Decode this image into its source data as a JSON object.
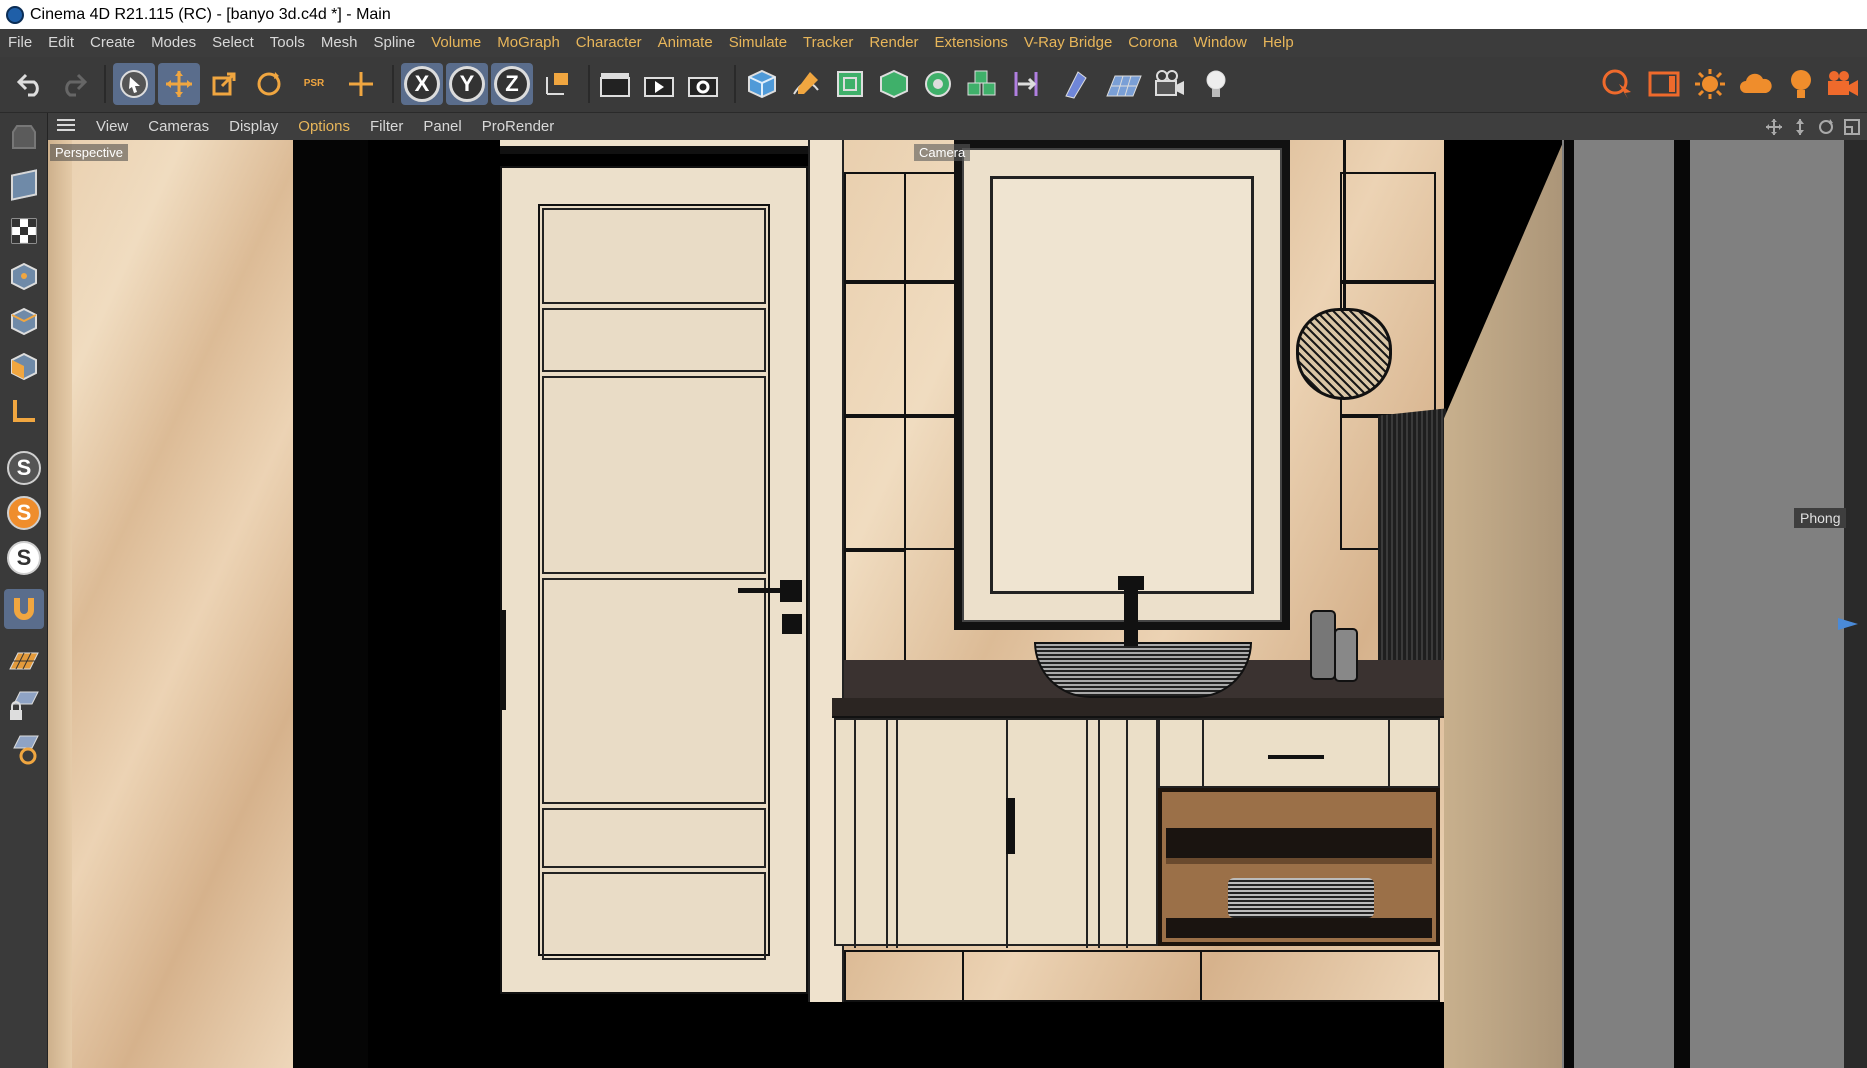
{
  "titlebar": {
    "title": "Cinema 4D R21.115 (RC) - [banyo 3d.c4d *] - Main"
  },
  "menu": [
    "File",
    "Edit",
    "Create",
    "Modes",
    "Select",
    "Tools",
    "Mesh",
    "Spline",
    "Volume",
    "MoGraph",
    "Character",
    "Animate",
    "Simulate",
    "Tracker",
    "Render",
    "Extensions",
    "V-Ray Bridge",
    "Corona",
    "Window",
    "Help"
  ],
  "menu_highlight": [
    "Volume",
    "MoGraph",
    "Character",
    "Animate",
    "Simulate",
    "Tracker",
    "Render",
    "Extensions",
    "V-Ray Bridge",
    "Corona",
    "Window",
    "Help"
  ],
  "toolbar": {
    "psr_label": "PSR",
    "axis_x": "X",
    "axis_y": "Y",
    "axis_z": "Z"
  },
  "viewport_menu": {
    "items": [
      "View",
      "Cameras",
      "Display",
      "Options",
      "Filter",
      "Panel",
      "ProRender"
    ],
    "highlight": "Options"
  },
  "viewport": {
    "view_name": "Perspective",
    "camera_label": "Camera",
    "material_label": "Phong"
  },
  "leftbar": {
    "s1": "S",
    "s2": "S",
    "s3": "S"
  },
  "colors": {
    "accent": "#e8b65a",
    "selected": "#5a6d8c",
    "orange_icon": "#ef8d2c"
  }
}
